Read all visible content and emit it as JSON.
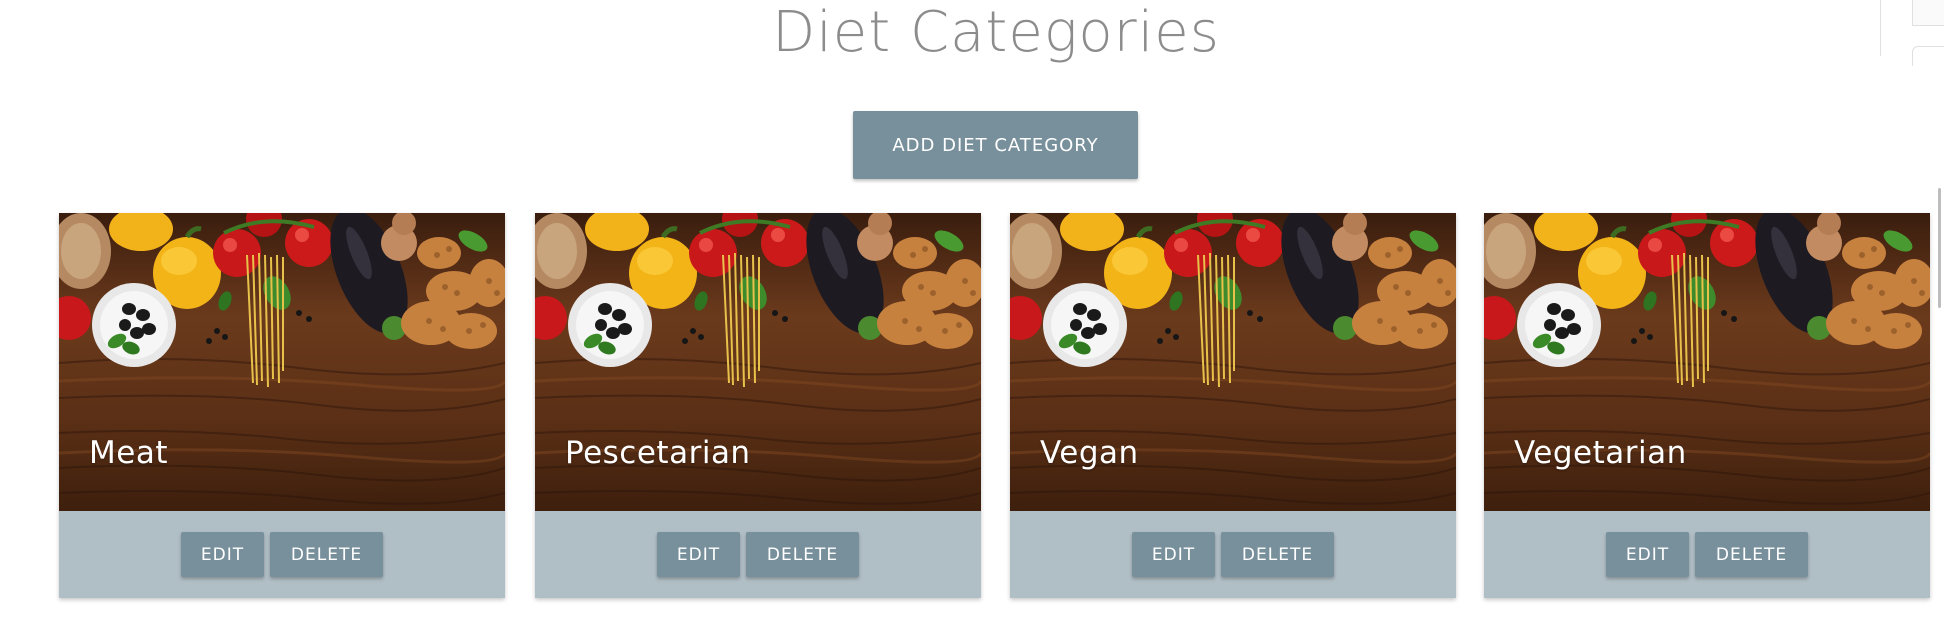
{
  "page": {
    "title": "Diet Categories",
    "add_button_label": "ADD DIET CATEGORY"
  },
  "cards": [
    {
      "title": "Meat",
      "edit_label": "EDIT",
      "delete_label": "DELETE"
    },
    {
      "title": "Pescetarian",
      "edit_label": "EDIT",
      "delete_label": "DELETE"
    },
    {
      "title": "Vegan",
      "edit_label": "EDIT",
      "delete_label": "DELETE"
    },
    {
      "title": "Vegetarian",
      "edit_label": "EDIT",
      "delete_label": "DELETE"
    }
  ],
  "colors": {
    "button": "#78909c",
    "card_actions_bg": "#b0bec5",
    "title_text": "#8c8c8c"
  }
}
